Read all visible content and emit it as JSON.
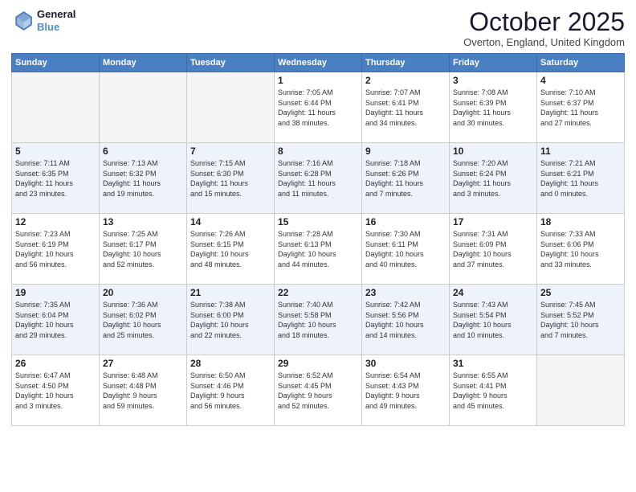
{
  "header": {
    "logo_line1": "General",
    "logo_line2": "Blue",
    "month": "October 2025",
    "location": "Overton, England, United Kingdom"
  },
  "days_of_week": [
    "Sunday",
    "Monday",
    "Tuesday",
    "Wednesday",
    "Thursday",
    "Friday",
    "Saturday"
  ],
  "weeks": [
    [
      {
        "num": "",
        "info": ""
      },
      {
        "num": "",
        "info": ""
      },
      {
        "num": "",
        "info": ""
      },
      {
        "num": "1",
        "info": "Sunrise: 7:05 AM\nSunset: 6:44 PM\nDaylight: 11 hours\nand 38 minutes."
      },
      {
        "num": "2",
        "info": "Sunrise: 7:07 AM\nSunset: 6:41 PM\nDaylight: 11 hours\nand 34 minutes."
      },
      {
        "num": "3",
        "info": "Sunrise: 7:08 AM\nSunset: 6:39 PM\nDaylight: 11 hours\nand 30 minutes."
      },
      {
        "num": "4",
        "info": "Sunrise: 7:10 AM\nSunset: 6:37 PM\nDaylight: 11 hours\nand 27 minutes."
      }
    ],
    [
      {
        "num": "5",
        "info": "Sunrise: 7:11 AM\nSunset: 6:35 PM\nDaylight: 11 hours\nand 23 minutes."
      },
      {
        "num": "6",
        "info": "Sunrise: 7:13 AM\nSunset: 6:32 PM\nDaylight: 11 hours\nand 19 minutes."
      },
      {
        "num": "7",
        "info": "Sunrise: 7:15 AM\nSunset: 6:30 PM\nDaylight: 11 hours\nand 15 minutes."
      },
      {
        "num": "8",
        "info": "Sunrise: 7:16 AM\nSunset: 6:28 PM\nDaylight: 11 hours\nand 11 minutes."
      },
      {
        "num": "9",
        "info": "Sunrise: 7:18 AM\nSunset: 6:26 PM\nDaylight: 11 hours\nand 7 minutes."
      },
      {
        "num": "10",
        "info": "Sunrise: 7:20 AM\nSunset: 6:24 PM\nDaylight: 11 hours\nand 3 minutes."
      },
      {
        "num": "11",
        "info": "Sunrise: 7:21 AM\nSunset: 6:21 PM\nDaylight: 11 hours\nand 0 minutes."
      }
    ],
    [
      {
        "num": "12",
        "info": "Sunrise: 7:23 AM\nSunset: 6:19 PM\nDaylight: 10 hours\nand 56 minutes."
      },
      {
        "num": "13",
        "info": "Sunrise: 7:25 AM\nSunset: 6:17 PM\nDaylight: 10 hours\nand 52 minutes."
      },
      {
        "num": "14",
        "info": "Sunrise: 7:26 AM\nSunset: 6:15 PM\nDaylight: 10 hours\nand 48 minutes."
      },
      {
        "num": "15",
        "info": "Sunrise: 7:28 AM\nSunset: 6:13 PM\nDaylight: 10 hours\nand 44 minutes."
      },
      {
        "num": "16",
        "info": "Sunrise: 7:30 AM\nSunset: 6:11 PM\nDaylight: 10 hours\nand 40 minutes."
      },
      {
        "num": "17",
        "info": "Sunrise: 7:31 AM\nSunset: 6:09 PM\nDaylight: 10 hours\nand 37 minutes."
      },
      {
        "num": "18",
        "info": "Sunrise: 7:33 AM\nSunset: 6:06 PM\nDaylight: 10 hours\nand 33 minutes."
      }
    ],
    [
      {
        "num": "19",
        "info": "Sunrise: 7:35 AM\nSunset: 6:04 PM\nDaylight: 10 hours\nand 29 minutes."
      },
      {
        "num": "20",
        "info": "Sunrise: 7:36 AM\nSunset: 6:02 PM\nDaylight: 10 hours\nand 25 minutes."
      },
      {
        "num": "21",
        "info": "Sunrise: 7:38 AM\nSunset: 6:00 PM\nDaylight: 10 hours\nand 22 minutes."
      },
      {
        "num": "22",
        "info": "Sunrise: 7:40 AM\nSunset: 5:58 PM\nDaylight: 10 hours\nand 18 minutes."
      },
      {
        "num": "23",
        "info": "Sunrise: 7:42 AM\nSunset: 5:56 PM\nDaylight: 10 hours\nand 14 minutes."
      },
      {
        "num": "24",
        "info": "Sunrise: 7:43 AM\nSunset: 5:54 PM\nDaylight: 10 hours\nand 10 minutes."
      },
      {
        "num": "25",
        "info": "Sunrise: 7:45 AM\nSunset: 5:52 PM\nDaylight: 10 hours\nand 7 minutes."
      }
    ],
    [
      {
        "num": "26",
        "info": "Sunrise: 6:47 AM\nSunset: 4:50 PM\nDaylight: 10 hours\nand 3 minutes."
      },
      {
        "num": "27",
        "info": "Sunrise: 6:48 AM\nSunset: 4:48 PM\nDaylight: 9 hours\nand 59 minutes."
      },
      {
        "num": "28",
        "info": "Sunrise: 6:50 AM\nSunset: 4:46 PM\nDaylight: 9 hours\nand 56 minutes."
      },
      {
        "num": "29",
        "info": "Sunrise: 6:52 AM\nSunset: 4:45 PM\nDaylight: 9 hours\nand 52 minutes."
      },
      {
        "num": "30",
        "info": "Sunrise: 6:54 AM\nSunset: 4:43 PM\nDaylight: 9 hours\nand 49 minutes."
      },
      {
        "num": "31",
        "info": "Sunrise: 6:55 AM\nSunset: 4:41 PM\nDaylight: 9 hours\nand 45 minutes."
      },
      {
        "num": "",
        "info": ""
      }
    ]
  ]
}
